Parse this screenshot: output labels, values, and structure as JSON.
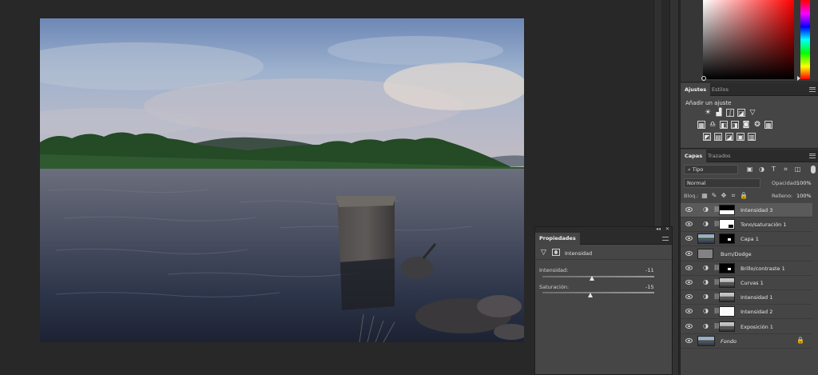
{
  "colors": {
    "workspace": "#282828",
    "panel": "#454545",
    "panel_dark": "#2b2b2b",
    "selected_layer": "#5a5a5a"
  },
  "color_panel": {
    "hue": "red"
  },
  "adjustments_panel": {
    "tabs": [
      {
        "label": "Ajustes",
        "active": true
      },
      {
        "label": "Estilos",
        "active": false
      }
    ],
    "title": "Añadir un ajuste",
    "rows": [
      [
        "brightness-icon",
        "levels-icon",
        "curves-icon",
        "exposure-icon",
        "gradient-triangle-icon"
      ],
      [
        "vibrance-icon",
        "hue-saturation-icon",
        "color-balance-icon",
        "black-white-icon",
        "photo-filter-icon",
        "channel-mixer-icon",
        "color-lookup-icon"
      ],
      [
        "invert-icon",
        "posterize-icon",
        "threshold-icon",
        "selective-color-icon",
        "gradient-map-icon"
      ]
    ]
  },
  "layers_panel": {
    "tabs": [
      {
        "label": "Capas",
        "active": true
      },
      {
        "label": "Trazados",
        "active": false
      }
    ],
    "filter": "Tipo",
    "blend_mode": "Normal",
    "opacity_label": "Opacidad:",
    "opacity_value": "100%",
    "lock_label": "Bloq.:",
    "fill_label": "Relleno:",
    "fill_value": "100%",
    "layers": [
      {
        "name": "Intensidad 3",
        "selected": true,
        "adjustment": true,
        "thumb": "mask-black-top"
      },
      {
        "name": "Tono/saturación 1",
        "selected": false,
        "adjustment": true,
        "thumb": "mask-white-corner"
      },
      {
        "name": "Capa 1",
        "selected": false,
        "adjustment": false,
        "thumb": "photo-with-mask"
      },
      {
        "name": "Burn/Dodge",
        "selected": false,
        "adjustment": false,
        "thumb": "grey"
      },
      {
        "name": "Brillo/contraste 1",
        "selected": false,
        "adjustment": true,
        "thumb": "mask-dot"
      },
      {
        "name": "Curvas 1",
        "selected": false,
        "adjustment": true,
        "thumb": "mask-photo"
      },
      {
        "name": "Intensidad 1",
        "selected": false,
        "adjustment": true,
        "thumb": "mask-photo"
      },
      {
        "name": "Intensidad 2",
        "selected": false,
        "adjustment": true,
        "thumb": "white"
      },
      {
        "name": "Exposición 1",
        "selected": false,
        "adjustment": true,
        "thumb": "mask-photo"
      },
      {
        "name": "Fondo",
        "selected": false,
        "adjustment": false,
        "thumb": "photo",
        "locked": true,
        "italic": true
      }
    ]
  },
  "properties_panel": {
    "tab": "Propiedades",
    "adjustment_name": "Intensidad",
    "sliders": [
      {
        "label": "Intensidad:",
        "value": "-11",
        "numeric": -11,
        "min": -100,
        "max": 100
      },
      {
        "label": "Saturación:",
        "value": "-15",
        "numeric": -15,
        "min": -100,
        "max": 100
      }
    ]
  }
}
